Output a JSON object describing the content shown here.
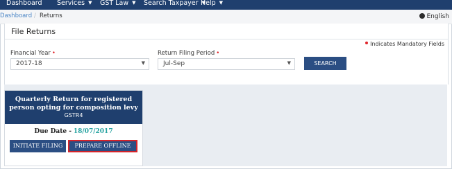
{
  "nav": {
    "items": [
      {
        "label": "Dashboard",
        "has_caret": false
      },
      {
        "label": "Services",
        "has_caret": true
      },
      {
        "label": "GST Law",
        "has_caret": true
      },
      {
        "label": "Search Taxpayer",
        "has_caret": true
      },
      {
        "label": "Help",
        "has_caret": true
      }
    ]
  },
  "breadcrumb": {
    "items": [
      "Dashboard",
      "Returns"
    ],
    "separator": "/"
  },
  "language": {
    "label": "English",
    "icon": "globe-icon"
  },
  "page": {
    "title": "File Returns",
    "mandatory_note": "Indicates Mandatory Fields"
  },
  "form": {
    "financial_year": {
      "label": "Financial Year",
      "value": "2017-18"
    },
    "return_period": {
      "label": "Return Filing Period",
      "value": "Jul-Sep"
    },
    "search_button": "SEARCH"
  },
  "card": {
    "title": "Quarterly Return for registered person opting for composition levy",
    "form_name": "GSTR4",
    "due_label": "Due Date -",
    "due_value": "18/07/2017",
    "initiate_button": "INITIATE FILING",
    "offline_button": "PREPARE OFFLINE"
  },
  "colors": {
    "nav_bg": "#1f3f6e",
    "button_bg": "#2b4e83",
    "accent_red": "#e0242a",
    "due_teal": "#25a2a0"
  }
}
